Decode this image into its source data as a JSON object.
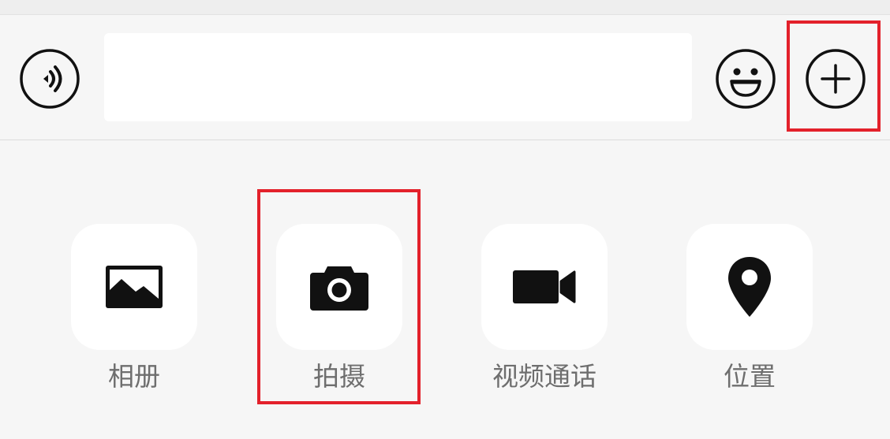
{
  "input_bar": {
    "voice_icon": "voice-icon",
    "text_value": "",
    "emoji_icon": "emoji-smile-icon",
    "more_icon": "plus-circle-icon"
  },
  "panel": {
    "items": [
      {
        "label": "相册",
        "icon": "image-icon"
      },
      {
        "label": "拍摄",
        "icon": "camera-icon"
      },
      {
        "label": "视频通话",
        "icon": "video-camera-icon"
      },
      {
        "label": "位置",
        "icon": "location-pin-icon"
      }
    ]
  },
  "colors": {
    "background": "#f6f6f6",
    "tile": "#ffffff",
    "icon": "#111111",
    "label": "#6e6e6e",
    "highlight": "#e3212b"
  }
}
